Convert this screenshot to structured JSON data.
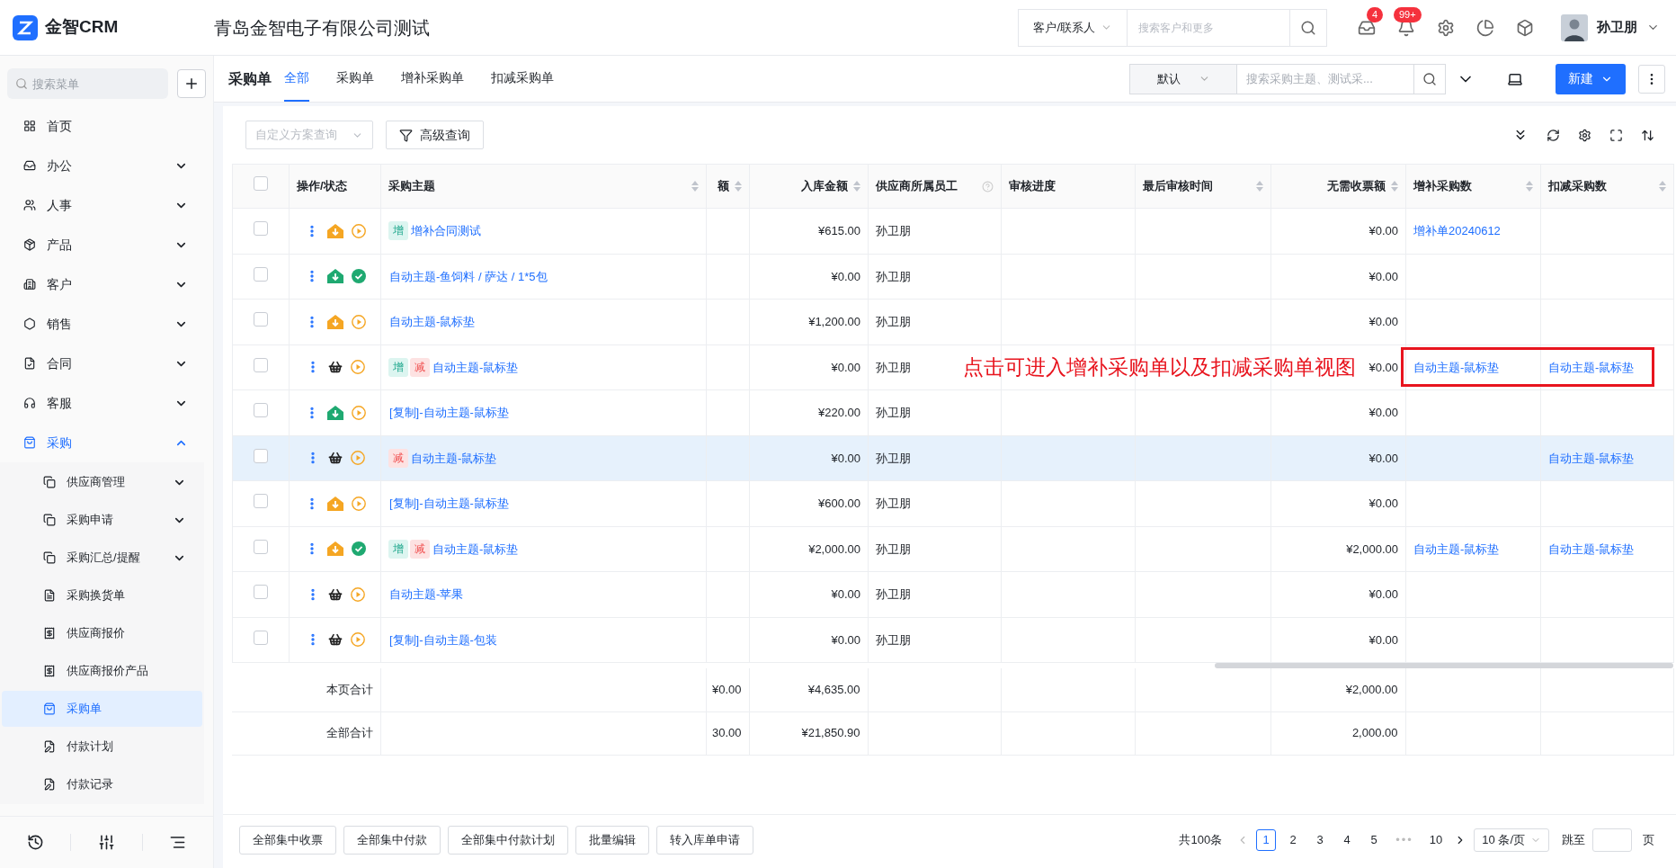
{
  "app": {
    "logo_text": "金智CRM",
    "company": "青岛金智电子有限公司测试",
    "search_scope": "客户/联系人",
    "search_placeholder": "搜索客户和更多",
    "inbox_badge": "4",
    "bell_badge": "99+",
    "user_name": "孙卫朋"
  },
  "sidebar": {
    "search_placeholder": "搜索菜单",
    "items": [
      {
        "label": "首页",
        "selected": false
      },
      {
        "label": "办公",
        "selected": false,
        "expanded": false
      },
      {
        "label": "人事",
        "selected": false,
        "expanded": false
      },
      {
        "label": "产品",
        "selected": false,
        "expanded": false
      },
      {
        "label": "客户",
        "selected": false,
        "expanded": false
      },
      {
        "label": "销售",
        "selected": false,
        "expanded": false
      },
      {
        "label": "合同",
        "selected": false,
        "expanded": false
      },
      {
        "label": "客服",
        "selected": false,
        "expanded": false
      },
      {
        "label": "采购",
        "selected": false,
        "expanded": true,
        "children": [
          {
            "label": "供应商管理",
            "selected": false,
            "expanded": false
          },
          {
            "label": "采购申请",
            "selected": false,
            "expanded": false
          },
          {
            "label": "采购汇总/提醒",
            "selected": false,
            "expanded": false
          },
          {
            "label": "采购换货单",
            "selected": false
          },
          {
            "label": "供应商报价",
            "selected": false
          },
          {
            "label": "供应商报价产品",
            "selected": false
          },
          {
            "label": "采购单",
            "selected": true
          },
          {
            "label": "付款计划",
            "selected": false
          },
          {
            "label": "付款记录",
            "selected": false
          }
        ]
      }
    ]
  },
  "page": {
    "title": "采购单",
    "tabs": [
      {
        "label": "全部",
        "selected": true
      },
      {
        "label": "采购单",
        "selected": false
      },
      {
        "label": "增补采购单",
        "selected": false
      },
      {
        "label": "扣减采购单",
        "selected": false
      }
    ],
    "view_select": "默认",
    "search_placeholder": "搜索采购主题、测试采...",
    "new_button": "新建",
    "scheme_placeholder": "自定义方案查询",
    "advanced_query": "高级查询"
  },
  "table": {
    "all_checked": false,
    "columns": [
      {
        "label": "操作/状态",
        "sortable": false
      },
      {
        "label": "采购主题",
        "sortable": true
      },
      {
        "label": "额",
        "sortable": true
      },
      {
        "label": "入库金额",
        "sortable": true
      },
      {
        "label": "供应商所属员工",
        "sortable": false,
        "help": true
      },
      {
        "label": "审核进度",
        "sortable": false
      },
      {
        "label": "最后审核时间",
        "sortable": true
      },
      {
        "label": "无需收票额",
        "sortable": true
      },
      {
        "label": "增补采购数",
        "sortable": true
      },
      {
        "label": "扣减采购数",
        "sortable": true
      }
    ],
    "rows": [
      {
        "checked": false,
        "selected": false,
        "kind": "partial",
        "approved": false,
        "tags": [
          {
            "label": "增",
            "kind": "add"
          }
        ],
        "subject": "增补合同测试",
        "stock_amount": "¥615.00",
        "employee": "孙卫朋",
        "no_invoice": "¥0.00",
        "add_orders": "增补单20240612"
      },
      {
        "checked": false,
        "selected": false,
        "kind": "full",
        "approved": true,
        "subject": "自动主题-鱼饲料 / 萨达 / 1*5包",
        "stock_amount": "¥0.00",
        "employee": "孙卫朋",
        "no_invoice": "¥0.00"
      },
      {
        "checked": false,
        "selected": false,
        "kind": "partial",
        "approved": false,
        "subject": "自动主题-鼠标垫",
        "stock_amount": "¥1,200.00",
        "employee": "孙卫朋",
        "no_invoice": "¥0.00"
      },
      {
        "checked": false,
        "selected": false,
        "kind": "basket",
        "approved": false,
        "tags": [
          {
            "label": "增",
            "kind": "add"
          },
          {
            "label": "减",
            "kind": "reduce"
          }
        ],
        "subject": "自动主题-鼠标垫",
        "stock_amount": "¥0.00",
        "employee": "孙卫朋",
        "no_invoice": "¥0.00",
        "add_orders": "自动主题-鼠标垫",
        "reduce_orders": "自动主题-鼠标垫",
        "annotated": true
      },
      {
        "checked": false,
        "selected": false,
        "kind": "full",
        "approved": false,
        "subject": "[复制]-自动主题-鼠标垫",
        "stock_amount": "¥220.00",
        "employee": "孙卫朋",
        "no_invoice": "¥0.00"
      },
      {
        "checked": false,
        "selected": true,
        "kind": "basket",
        "approved": false,
        "tags": [
          {
            "label": "减",
            "kind": "reduce"
          }
        ],
        "subject": "自动主题-鼠标垫",
        "stock_amount": "¥0.00",
        "employee": "孙卫朋",
        "no_invoice": "¥0.00",
        "reduce_orders": "自动主题-鼠标垫"
      },
      {
        "checked": false,
        "selected": false,
        "kind": "partial",
        "approved": false,
        "subject": "[复制]-自动主题-鼠标垫",
        "stock_amount": "¥600.00",
        "employee": "孙卫朋",
        "no_invoice": "¥0.00"
      },
      {
        "checked": false,
        "selected": false,
        "kind": "partial",
        "approved": true,
        "tags": [
          {
            "label": "增",
            "kind": "add"
          },
          {
            "label": "减",
            "kind": "reduce"
          }
        ],
        "subject": "自动主题-鼠标垫",
        "stock_amount": "¥2,000.00",
        "employee": "孙卫朋",
        "no_invoice": "¥2,000.00",
        "add_orders": "自动主题-鼠标垫",
        "reduce_orders": "自动主题-鼠标垫"
      },
      {
        "checked": false,
        "selected": false,
        "kind": "basket",
        "approved": false,
        "subject": "自动主题-苹果",
        "stock_amount": "¥0.00",
        "employee": "孙卫朋",
        "no_invoice": "¥0.00"
      },
      {
        "checked": false,
        "selected": false,
        "kind": "basket",
        "approved": false,
        "subject": "[复制]-自动主题-包装",
        "stock_amount": "¥0.00",
        "employee": "孙卫朋",
        "no_invoice": "¥0.00"
      }
    ],
    "totals": [
      {
        "label": "本页合计",
        "amount": "¥0.00",
        "stock_amount": "¥4,635.00",
        "no_invoice": "¥2,000.00"
      },
      {
        "label": "全部合计",
        "amount": "30.00",
        "stock_amount": "¥21,850.90",
        "no_invoice": "2,000.00"
      }
    ]
  },
  "annotation": {
    "text": "点击可进入增补采购单以及扣减采购单视图"
  },
  "bulk_buttons": [
    "全部集中收票",
    "全部集中付款",
    "全部集中付款计划",
    "批量编辑",
    "转入库单申请"
  ],
  "pagination": {
    "total": "共100条",
    "pages": [
      {
        "label": "1",
        "selected": true
      },
      {
        "label": "2",
        "selected": false
      },
      {
        "label": "3",
        "selected": false
      },
      {
        "label": "4",
        "selected": false
      },
      {
        "label": "5",
        "selected": false
      },
      {
        "label": "•••",
        "kind": "ellipsis",
        "selected": false
      },
      {
        "label": "10",
        "selected": false
      }
    ],
    "page_size": "10 条/页",
    "jump_label": "跳至",
    "page_unit": "页"
  }
}
